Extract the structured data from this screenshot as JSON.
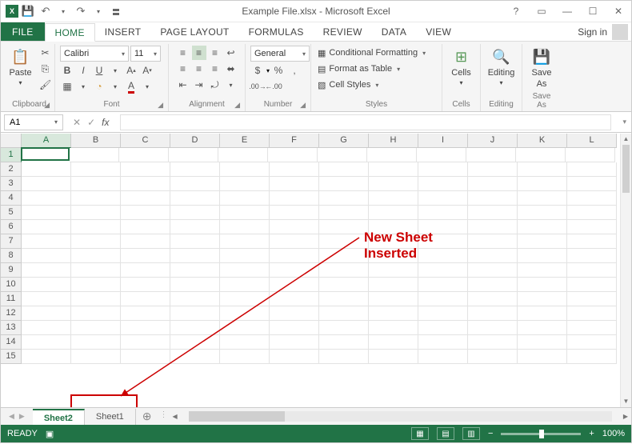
{
  "title": "Example File.xlsx - Microsoft Excel",
  "qat": {
    "save_tip": "Save",
    "undo_tip": "Undo",
    "redo_tip": "Redo"
  },
  "tabs": [
    "FILE",
    "HOME",
    "INSERT",
    "PAGE LAYOUT",
    "FORMULAS",
    "REVIEW",
    "DATA",
    "VIEW"
  ],
  "active_tab": 1,
  "signin": "Sign in",
  "ribbon": {
    "clipboard": {
      "label": "Clipboard",
      "paste": "Paste"
    },
    "font": {
      "label": "Font",
      "family": "Calibri",
      "size": "11"
    },
    "alignment": {
      "label": "Alignment"
    },
    "number": {
      "label": "Number",
      "format": "General"
    },
    "styles": {
      "label": "Styles",
      "cond": "Conditional Formatting",
      "table": "Format as Table",
      "cell": "Cell Styles"
    },
    "cells": {
      "label": "Cells",
      "btn": "Cells"
    },
    "editing": {
      "label": "Editing",
      "btn": "Editing"
    },
    "saveas": {
      "label": "Save As",
      "btn1": "Save",
      "btn2": "As"
    }
  },
  "namebox": "A1",
  "columns": [
    "A",
    "B",
    "C",
    "D",
    "E",
    "F",
    "G",
    "H",
    "I",
    "J",
    "K",
    "L"
  ],
  "rows": [
    "1",
    "2",
    "3",
    "4",
    "5",
    "6",
    "7",
    "8",
    "9",
    "10",
    "11",
    "12",
    "13",
    "14",
    "15"
  ],
  "sheets": {
    "active": "Sheet2",
    "other": "Sheet1"
  },
  "status": {
    "ready": "READY",
    "zoom": "100%"
  },
  "annotation": {
    "line1": "New Sheet",
    "line2": "Inserted"
  }
}
